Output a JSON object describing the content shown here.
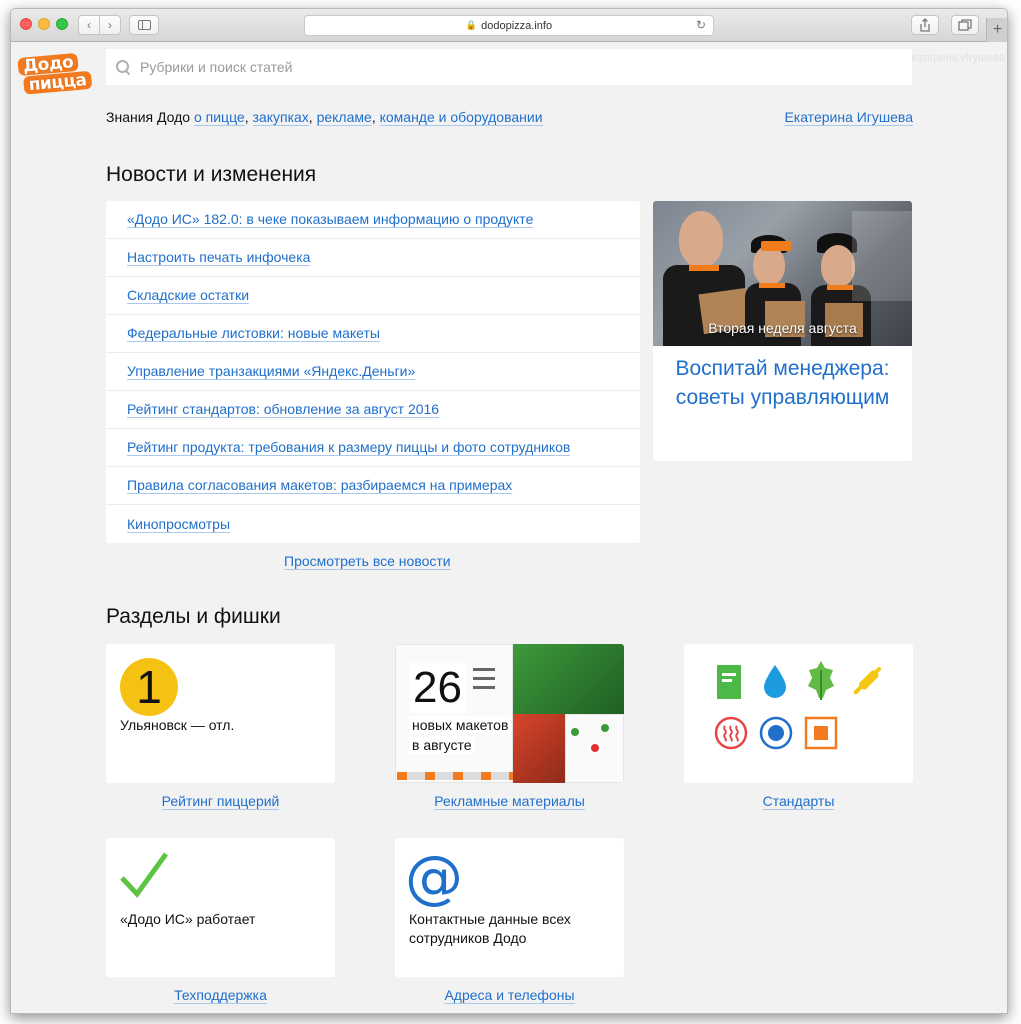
{
  "browser": {
    "url": "dodopizza.info",
    "back_glyph": "‹",
    "forward_glyph": "›",
    "reload_glyph": "↻",
    "lock_glyph": "🔒",
    "new_tab_glyph": "+"
  },
  "header": {
    "logo_top": "Додо",
    "logo_bottom": "пицца",
    "greeting": "Привет, Екатерина Игушева",
    "search_placeholder": "Рубрики и поиск статей",
    "knowledge_prefix": "Знания Додо ",
    "knowledge_links": [
      "о пицце",
      "закупках",
      "рекламе",
      "команде и оборудовании"
    ],
    "author": "Екатерина Игушева"
  },
  "news": {
    "title": "Новости и изменения",
    "items": [
      "«Додо ИС» 182.0: в чеке показываем информацию о продукте",
      "Настроить печать инфочека",
      "Складские остатки",
      "Федеральные листовки: новые макеты",
      "Управление транзакциями «Яндекс.Деньги»",
      "Рейтинг стандартов: обновление за август 2016",
      "Рейтинг продукта: требования к размеру пиццы и фото сотрудников",
      "Правила согласования макетов: разбираемся на примерах",
      "Кинопросмотры"
    ],
    "view_all": "Просмотреть все новости",
    "promo": {
      "caption": "Вторая неделя августа",
      "title": "Воспитай менеджера: советы управляющим"
    }
  },
  "sections": {
    "title": "Разделы и фишки",
    "rating": {
      "badge": "1",
      "text": "Ульяновск — отл.",
      "link": "Рейтинг пиццерий"
    },
    "ads": {
      "count": "26",
      "line1": "новых макетов",
      "line2": "в августе",
      "link": "Рекламные материалы"
    },
    "standards": {
      "link": "Стандарты",
      "icons": [
        "document-icon",
        "drop-icon",
        "leaf-icon",
        "rolling-pin-icon",
        "heat-icon",
        "target-icon",
        "square-icon"
      ]
    },
    "support": {
      "text": "«Додо ИС» работает",
      "link": "Техподдержка"
    },
    "contacts": {
      "icon": "@",
      "line1": "Контактные данные всех",
      "line2": "сотрудников Додо",
      "link": "Адреса и телефоны"
    }
  },
  "colors": {
    "link": "#1f6fcb",
    "page_bg": "#f3f2f3",
    "brand_orange": "#f37a1f",
    "badge_yellow": "#f5c214",
    "check_green": "#5cc443"
  }
}
